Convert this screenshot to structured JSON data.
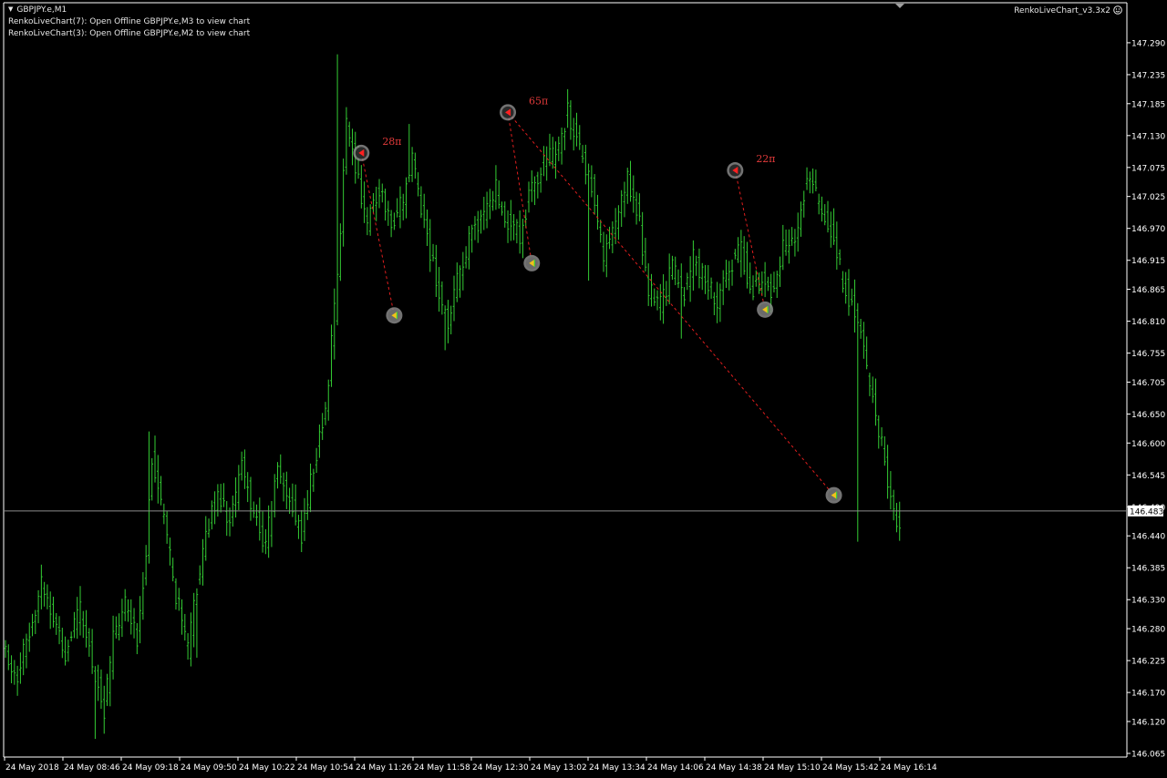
{
  "header": {
    "symbol": "GBPJPY.e,M1",
    "indicator_lines": [
      "RenkoLiveChart(7): Open Offline GBPJPY.e,M3 to view chart",
      "RenkoLiveChart(3): Open Offline GBPJPY.e,M2 to view chart"
    ],
    "expert_name": "RenkoLiveChart_v3.3x2",
    "expert_icon": "smiley-icon"
  },
  "colors": {
    "background": "#000000",
    "bars": "#33cc33",
    "axis": "#ffffff",
    "annotation_text": "#e23a3a",
    "zigzag": "#e01e1e",
    "current_price_line": "#8c8c8c",
    "marker_ring": "#9a9a9a"
  },
  "chart_data": {
    "type": "bar",
    "symbol": "GBPJPY.e",
    "timeframe": "M1",
    "ylim": [
      146.065,
      147.315
    ],
    "y_ticks": [
      "147.290",
      "147.235",
      "147.185",
      "147.130",
      "147.075",
      "147.025",
      "146.970",
      "146.915",
      "146.865",
      "146.810",
      "146.755",
      "146.705",
      "146.650",
      "146.600",
      "146.545",
      "146.490",
      "146.440",
      "146.385",
      "146.330",
      "146.280",
      "146.225",
      "146.170",
      "146.120",
      "146.065"
    ],
    "x_ticks": [
      "24 May 2018",
      "24 May 08:46",
      "24 May 09:18",
      "24 May 09:50",
      "24 May 10:22",
      "24 May 10:54",
      "24 May 11:26",
      "24 May 11:58",
      "24 May 12:30",
      "24 May 13:02",
      "24 May 13:34",
      "24 May 14:06",
      "24 May 14:38",
      "24 May 15:10",
      "24 May 15:42",
      "24 May 16:14"
    ],
    "bar_count": 300,
    "close_path": [
      [
        0,
        146.24
      ],
      [
        4,
        146.2
      ],
      [
        8,
        146.28
      ],
      [
        12,
        146.36
      ],
      [
        16,
        146.3
      ],
      [
        20,
        146.24
      ],
      [
        25,
        146.31
      ],
      [
        29,
        146.22
      ],
      [
        33,
        146.14
      ],
      [
        36,
        146.26
      ],
      [
        40,
        146.32
      ],
      [
        44,
        146.26
      ],
      [
        47,
        146.42
      ],
      [
        49,
        146.58
      ],
      [
        53,
        146.46
      ],
      [
        57,
        146.34
      ],
      [
        61,
        146.24
      ],
      [
        63,
        146.32
      ],
      [
        67,
        146.44
      ],
      [
        71,
        146.52
      ],
      [
        75,
        146.46
      ],
      [
        79,
        146.56
      ],
      [
        83,
        146.48
      ],
      [
        87,
        146.42
      ],
      [
        91,
        146.56
      ],
      [
        95,
        146.5
      ],
      [
        99,
        146.44
      ],
      [
        103,
        146.56
      ],
      [
        107,
        146.66
      ],
      [
        111,
        146.88
      ],
      [
        114,
        147.16
      ],
      [
        117,
        147.08
      ],
      [
        121,
        146.98
      ],
      [
        125,
        147.04
      ],
      [
        129,
        146.98
      ],
      [
        133,
        147.02
      ],
      [
        136,
        147.09
      ],
      [
        140,
        146.98
      ],
      [
        144,
        146.88
      ],
      [
        148,
        146.8
      ],
      [
        152,
        146.9
      ],
      [
        156,
        146.96
      ],
      [
        160,
        147.0
      ],
      [
        164,
        147.04
      ],
      [
        168,
        146.98
      ],
      [
        172,
        146.96
      ],
      [
        176,
        147.04
      ],
      [
        180,
        147.08
      ],
      [
        184,
        147.1
      ],
      [
        188,
        147.17
      ],
      [
        192,
        147.1
      ],
      [
        196,
        147.05
      ],
      [
        200,
        146.92
      ],
      [
        204,
        146.97
      ],
      [
        208,
        147.06
      ],
      [
        212,
        146.98
      ],
      [
        215,
        146.86
      ],
      [
        219,
        146.84
      ],
      [
        223,
        146.9
      ],
      [
        227,
        146.86
      ],
      [
        230,
        146.92
      ],
      [
        234,
        146.88
      ],
      [
        238,
        146.84
      ],
      [
        242,
        146.9
      ],
      [
        246,
        146.94
      ],
      [
        249,
        146.86
      ],
      [
        253,
        146.88
      ],
      [
        257,
        146.86
      ],
      [
        260,
        146.94
      ],
      [
        264,
        146.96
      ],
      [
        268,
        147.06
      ],
      [
        272,
        147.02
      ],
      [
        276,
        146.96
      ],
      [
        280,
        146.88
      ],
      [
        283,
        146.84
      ],
      [
        286,
        146.78
      ],
      [
        289,
        146.7
      ],
      [
        292,
        146.62
      ],
      [
        295,
        146.54
      ],
      [
        297,
        146.48
      ],
      [
        299,
        146.46
      ]
    ],
    "extremes": [
      [
        30,
        146.09
      ],
      [
        48,
        146.62
      ],
      [
        64,
        146.23
      ],
      [
        111,
        147.27
      ],
      [
        147,
        146.76
      ],
      [
        135,
        147.15
      ],
      [
        188,
        147.19
      ],
      [
        195,
        146.88
      ],
      [
        226,
        146.78
      ],
      [
        285,
        146.43
      ]
    ],
    "zigzag_points": [
      {
        "bar": 119,
        "price": 147.1,
        "kind": "high",
        "label": "28п"
      },
      {
        "bar": 130,
        "price": 146.82,
        "kind": "low",
        "label": ""
      },
      {
        "bar": 168,
        "price": 147.17,
        "kind": "high",
        "label": "65п"
      },
      {
        "bar": 176,
        "price": 146.91,
        "kind": "low",
        "label": ""
      },
      {
        "bar": 244,
        "price": 147.07,
        "kind": "high",
        "label": "22п"
      },
      {
        "bar": 254,
        "price": 146.83,
        "kind": "low",
        "label": ""
      },
      {
        "bar": 277,
        "price": 146.51,
        "kind": "low",
        "label": ""
      }
    ],
    "zigzag_lines": [
      [
        119,
        130
      ],
      [
        168,
        176
      ],
      [
        168,
        277
      ],
      [
        244,
        254
      ]
    ],
    "current_price": "146.483",
    "current_price_value": 146.483,
    "grid": false,
    "legend": "none"
  }
}
